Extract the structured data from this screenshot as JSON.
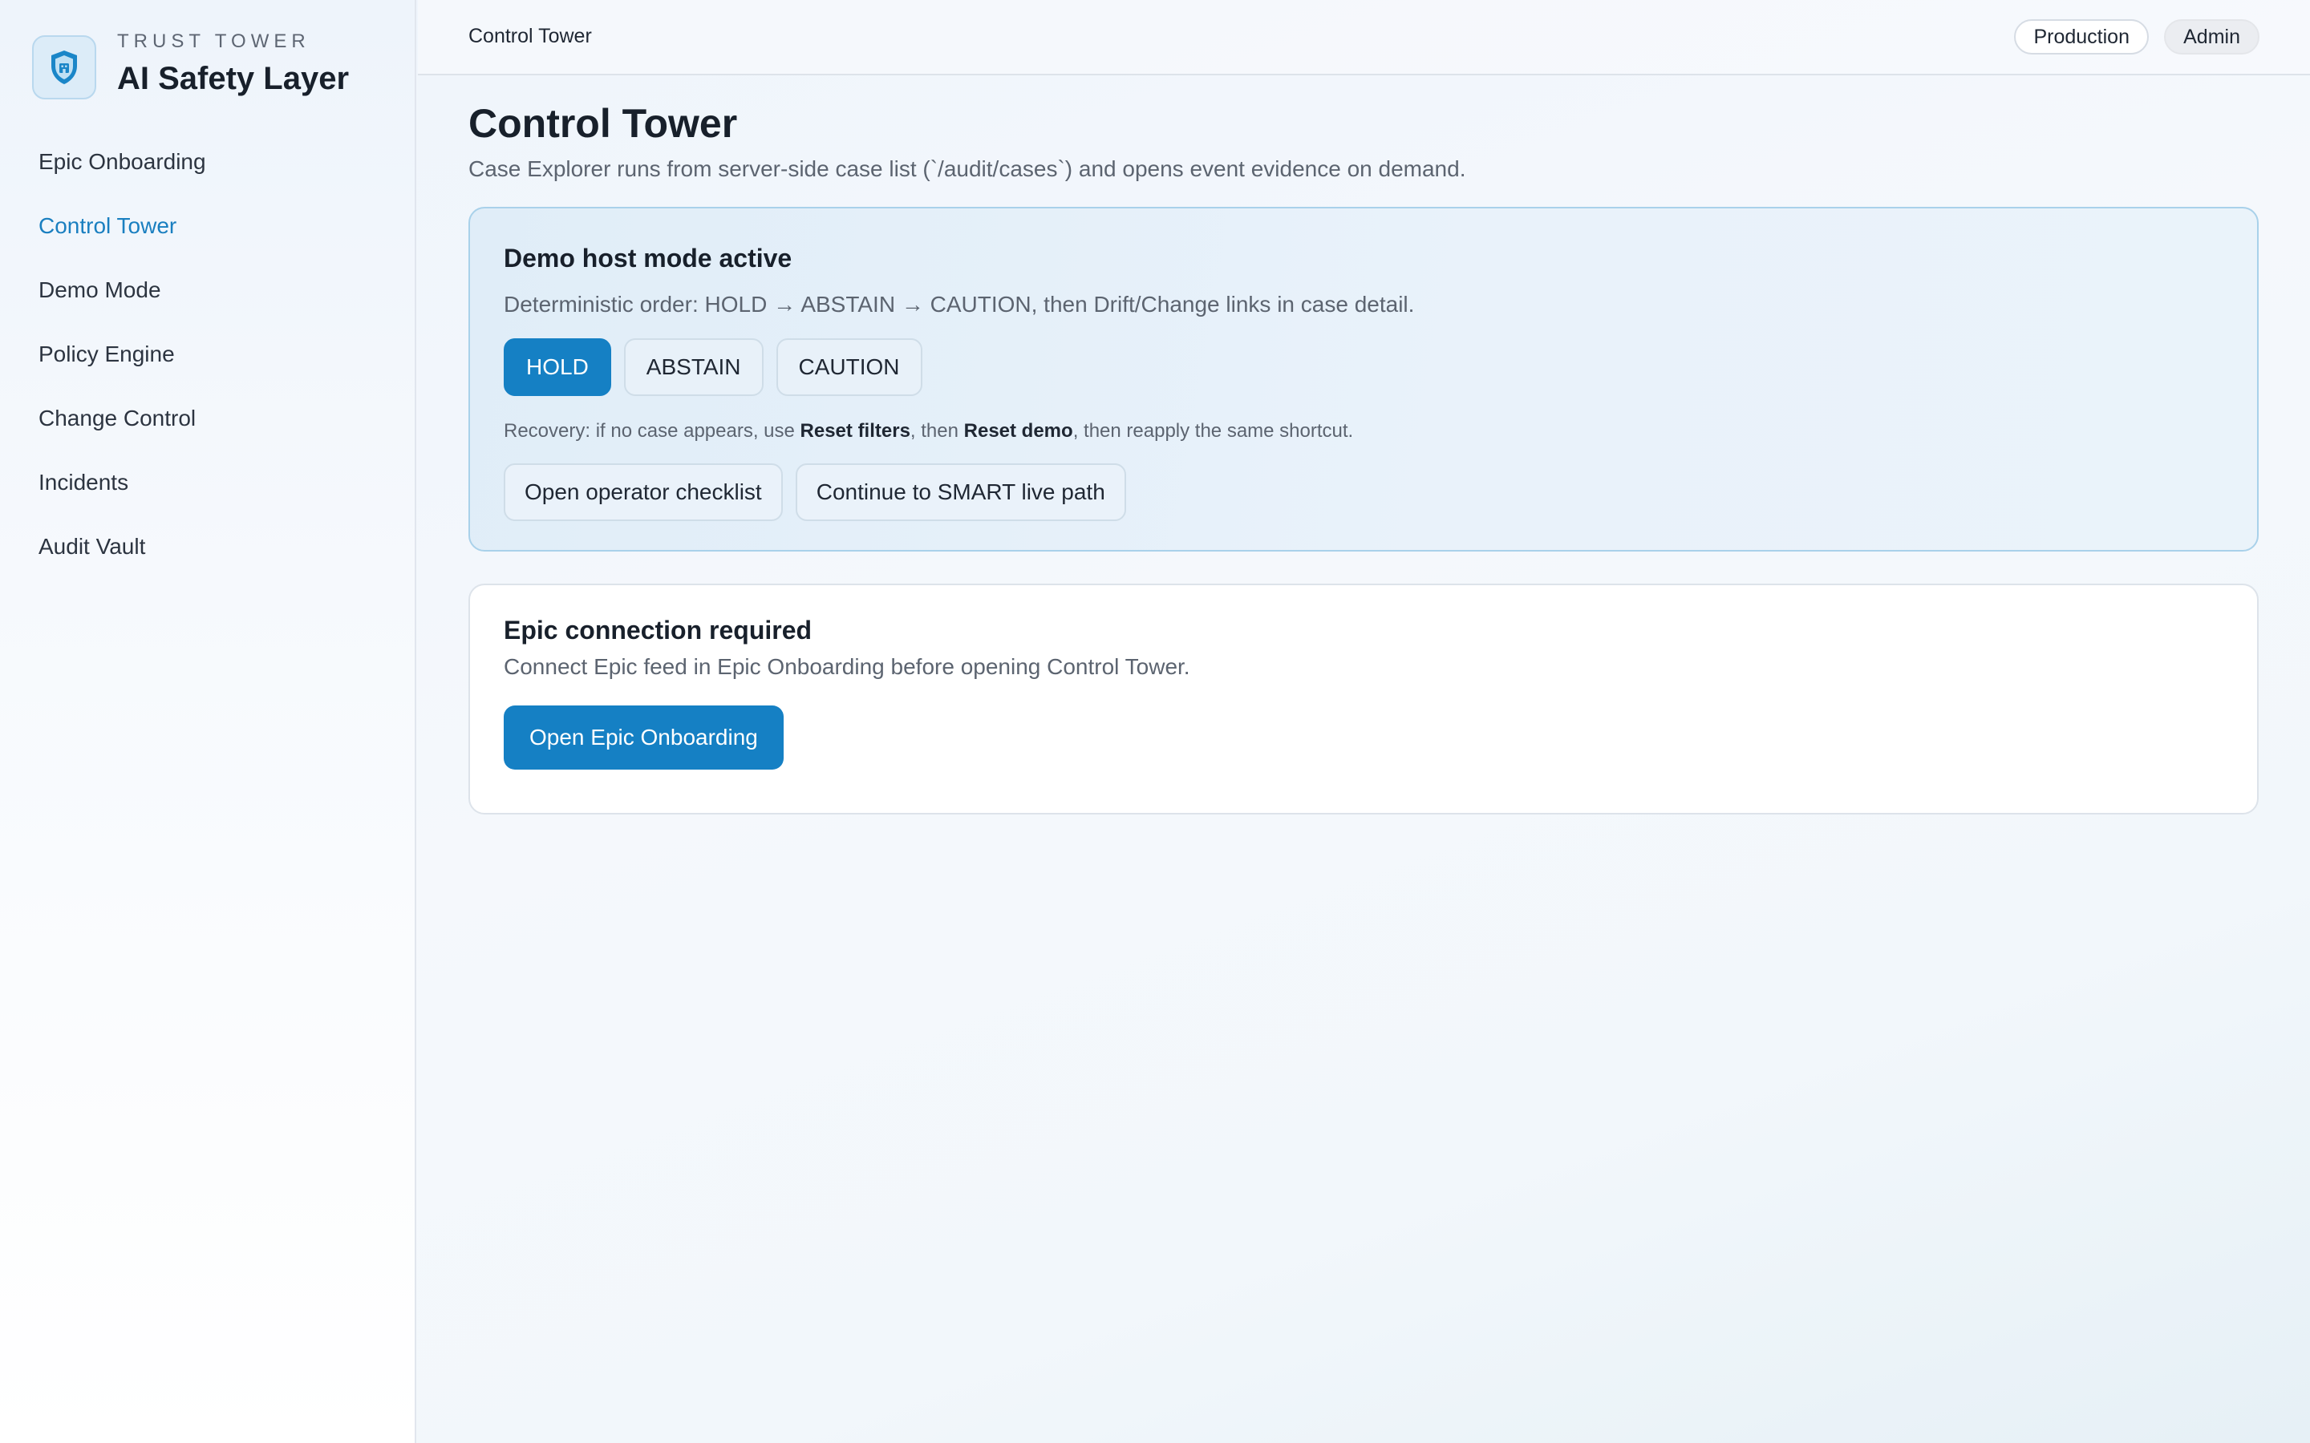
{
  "brand": {
    "eyebrow": "TRUST TOWER",
    "title": "AI Safety Layer",
    "logo_icon": "shield-icon"
  },
  "sidebar": {
    "items": [
      {
        "label": "Epic Onboarding",
        "active": false
      },
      {
        "label": "Control Tower",
        "active": true
      },
      {
        "label": "Demo Mode",
        "active": false
      },
      {
        "label": "Policy Engine",
        "active": false
      },
      {
        "label": "Change Control",
        "active": false
      },
      {
        "label": "Incidents",
        "active": false
      },
      {
        "label": "Audit Vault",
        "active": false
      }
    ]
  },
  "topbar": {
    "title": "Control Tower",
    "environment": "Production",
    "role": "Admin"
  },
  "page": {
    "title": "Control Tower",
    "subtitle": "Case Explorer runs from server-side case list (`/audit/cases`) and opens event evidence on demand."
  },
  "demo_card": {
    "title": "Demo host mode active",
    "description": "Deterministic order: HOLD → ABSTAIN → CAUTION, then Drift/Change links in case detail.",
    "shortcuts": [
      {
        "label": "HOLD",
        "active": true
      },
      {
        "label": "ABSTAIN",
        "active": false
      },
      {
        "label": "CAUTION",
        "active": false
      }
    ],
    "recovery": {
      "prefix": "Recovery: if no case appears, use ",
      "reset_filters": "Reset filters",
      "middle": ", then ",
      "reset_demo": "Reset demo",
      "suffix": ", then reapply the same shortcut."
    },
    "actions": {
      "checklist": "Open operator checklist",
      "smart": "Continue to SMART live path"
    }
  },
  "epic_card": {
    "title": "Epic connection required",
    "description": "Connect Epic feed in Epic Onboarding before opening Control Tower.",
    "button": "Open Epic Onboarding"
  },
  "colors": {
    "accent": "#1580c4",
    "active_nav": "#1a7fc0",
    "demo_card_border": "#a9d1ea"
  }
}
